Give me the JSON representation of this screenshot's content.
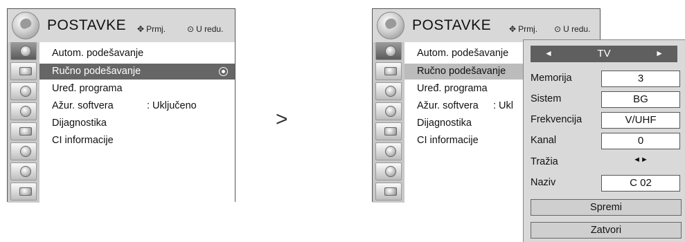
{
  "menu": {
    "title": "POSTAVKE",
    "hint_move": "Prmj.",
    "hint_ok": "U redu.",
    "icons": [
      "satellite-icon",
      "monitor-icon",
      "speaker-icon",
      "clock-icon",
      "toolbox-icon",
      "lock-icon",
      "option-icon",
      "usb-icon"
    ],
    "items": [
      {
        "label": "Autom. podešavanje",
        "value": ""
      },
      {
        "label": "Ručno podešavanje",
        "value": ""
      },
      {
        "label": "Uređ. programa",
        "value": ""
      },
      {
        "label": "Ažur. softvera",
        "value": ": Uključeno"
      },
      {
        "label": "Dijagnostika",
        "value": ""
      },
      {
        "label": "CI informacije",
        "value": ""
      }
    ]
  },
  "right_menu_value": ": Ukl",
  "arrow": ">",
  "panel": {
    "mode": "TV",
    "left_arrow": "◄",
    "right_arrow": "►",
    "rows": [
      {
        "label": "Memorija",
        "value": "3"
      },
      {
        "label": "Sistem",
        "value": "BG"
      },
      {
        "label": "Frekvencija",
        "value": "V/UHF"
      },
      {
        "label": "Kanal",
        "value": "0"
      },
      {
        "label": "Tražia",
        "value": "◄►"
      },
      {
        "label": "Naziv",
        "value": "C  02"
      }
    ],
    "save": "Spremi",
    "close": "Zatvori"
  }
}
